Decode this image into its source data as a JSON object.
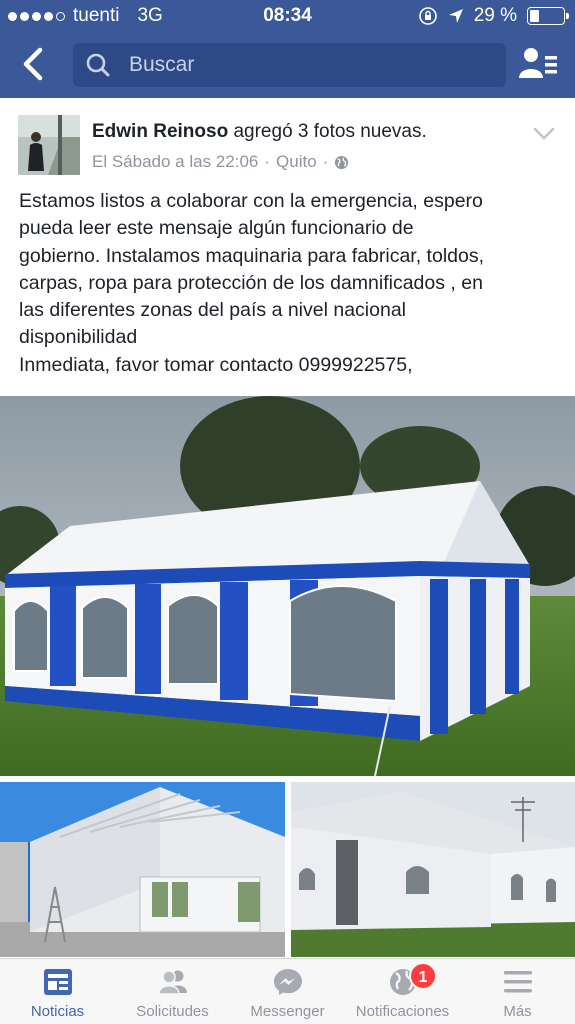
{
  "status_bar": {
    "carrier": "tuenti",
    "network": "3G",
    "time": "08:34",
    "battery_percent": "29 %",
    "battery_level": 0.29
  },
  "search": {
    "placeholder": "Buscar"
  },
  "post": {
    "author": "Edwin Reinoso",
    "action": "agregó 3 fotos nuevas.",
    "time": "El Sábado a las 22:06",
    "separator": "·",
    "location": "Quito",
    "privacy_icon": "globe-icon",
    "text_lines": [
      "Estamos listos a colaborar con la emergencia, espero",
      "pueda leer este mensaje algún funcionario de",
      "gobierno. Instalamos maquinaria para fabricar, toldos,",
      "carpas, ropa para protección de los damnificados , en",
      "las diferentes zonas del país a nivel nacional",
      "disponibilidad",
      "Inmediata, favor tomar contacto 0999922575,"
    ]
  },
  "tabs": [
    {
      "label": "Noticias",
      "icon": "news-feed-icon",
      "active": true
    },
    {
      "label": "Solicitudes",
      "icon": "friend-requests-icon",
      "active": false
    },
    {
      "label": "Messenger",
      "icon": "messenger-icon",
      "active": false
    },
    {
      "label": "Notificaciones",
      "icon": "globe-icon",
      "active": false,
      "badge": "1"
    },
    {
      "label": "Más",
      "icon": "menu-icon",
      "active": false
    }
  ],
  "colors": {
    "header": "#3b5998",
    "search_box": "#2d4a86",
    "active_tab": "#4267b2",
    "badge": "#fa3e3e"
  }
}
